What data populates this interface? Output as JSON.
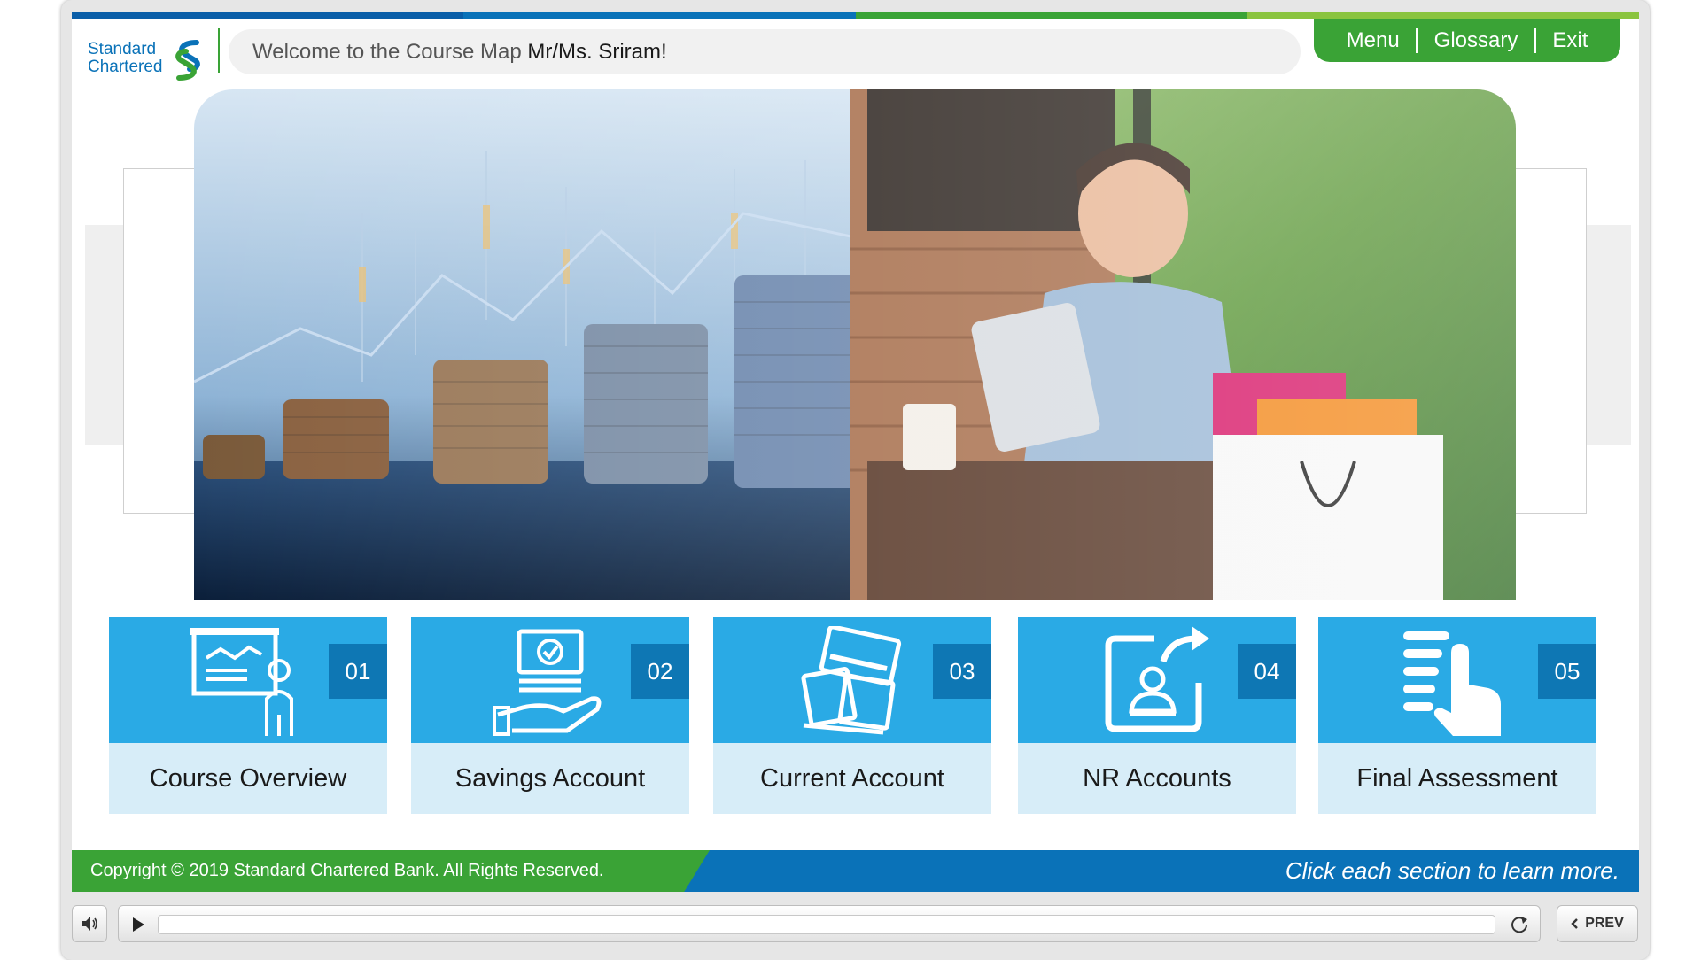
{
  "header": {
    "logo_line1": "Standard",
    "logo_line2": "Chartered",
    "welcome_prefix": "Welcome to the Course Map ",
    "welcome_name": "Mr/Ms. Sriram!"
  },
  "nav": {
    "menu": "Menu",
    "glossary": "Glossary",
    "exit": "Exit"
  },
  "colors": {
    "brand_blue": "#0a72b8",
    "brand_green": "#3aa336",
    "tile_blue": "#2aaae5",
    "tile_light": "#d7edf8",
    "number_blue": "#0e77b4"
  },
  "tiles": [
    {
      "number": "01",
      "label": "Course Overview",
      "icon": "presentation-chart-icon"
    },
    {
      "number": "02",
      "label": "Savings Account",
      "icon": "money-hand-icon"
    },
    {
      "number": "03",
      "label": "Current Account",
      "icon": "cards-cash-icon"
    },
    {
      "number": "04",
      "label": "NR Accounts",
      "icon": "user-transfer-icon"
    },
    {
      "number": "05",
      "label": "Final Assessment",
      "icon": "checklist-tap-icon"
    }
  ],
  "footer": {
    "copyright": "Copyright © 2019 Standard Chartered Bank. All Rights Reserved.",
    "hint": "Click each section to learn more."
  },
  "controls": {
    "prev_label": "PREV",
    "progress": 0
  }
}
